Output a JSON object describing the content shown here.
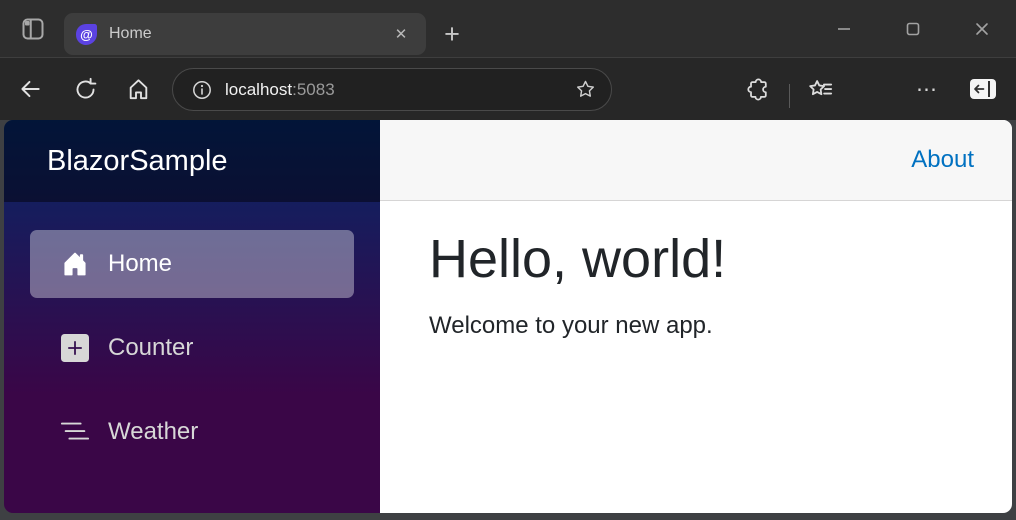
{
  "browser": {
    "tab": {
      "title": "Home"
    },
    "address": {
      "host": "localhost",
      "port": ":5083"
    },
    "icons": {
      "tab_close": "✕",
      "new_tab": "+",
      "overflow_menu": "⋯",
      "tab_actions": "tab-actions-menu",
      "back": "back-arrow",
      "refresh": "refresh-circle",
      "home": "home-house",
      "site_info": "info-circle",
      "bookmark": "star-outline",
      "extensions": "puzzle-piece",
      "favorites": "star-with-lines",
      "sidebar_toggle": "panel-with-left-arrow",
      "minimize": "–",
      "maximize": "▢",
      "close": "✕"
    }
  },
  "app": {
    "sidebar": {
      "brand": "BlazorSample",
      "items": [
        {
          "label": "Home",
          "icon": "house-icon",
          "active": true
        },
        {
          "label": "Counter",
          "icon": "plus-square-icon",
          "active": false
        },
        {
          "label": "Weather",
          "icon": "list-nested-icon",
          "active": false
        }
      ]
    },
    "topbar": {
      "about_label": "About"
    },
    "content": {
      "heading": "Hello, world!",
      "subtitle": "Welcome to your new app."
    }
  },
  "colors": {
    "link_accent": "#0071c1",
    "sidebar_gradient_top": "#052767",
    "sidebar_gradient_bottom": "#3a0647",
    "active_item_bg": "rgba(255,255,255,0.37)",
    "top_row_bg": "#f7f7f7",
    "top_row_border": "#d6d5d5",
    "chrome_bg": "#2d2d2d",
    "navbar_bg": "#272727",
    "tab_bg": "#3d3d3d",
    "favicon_purple": "#5b42e2"
  }
}
